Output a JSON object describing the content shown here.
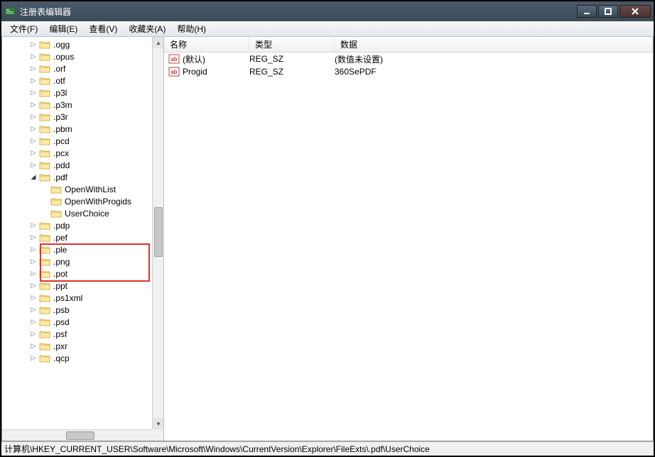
{
  "title": "注册表编辑器",
  "menu": [
    "文件(F)",
    "编辑(E)",
    "查看(V)",
    "收藏夹(A)",
    "帮助(H)"
  ],
  "tree": {
    "indent_base": 38,
    "child_indent": 54,
    "items": [
      {
        "label": ".ogg",
        "expander": "closed"
      },
      {
        "label": ".opus",
        "expander": "closed"
      },
      {
        "label": ".orf",
        "expander": "closed"
      },
      {
        "label": ".otf",
        "expander": "closed"
      },
      {
        "label": ".p3l",
        "expander": "closed"
      },
      {
        "label": ".p3m",
        "expander": "closed"
      },
      {
        "label": ".p3r",
        "expander": "closed"
      },
      {
        "label": ".pbm",
        "expander": "closed"
      },
      {
        "label": ".pcd",
        "expander": "closed"
      },
      {
        "label": ".pcx",
        "expander": "closed"
      },
      {
        "label": ".pdd",
        "expander": "closed"
      },
      {
        "label": ".pdf",
        "expander": "open",
        "children": [
          {
            "label": "OpenWithList"
          },
          {
            "label": "OpenWithProgids"
          },
          {
            "label": "UserChoice"
          }
        ]
      },
      {
        "label": ".pdp",
        "expander": "closed"
      },
      {
        "label": ".pef",
        "expander": "closed"
      },
      {
        "label": ".ple",
        "expander": "closed"
      },
      {
        "label": ".png",
        "expander": "closed"
      },
      {
        "label": ".pot",
        "expander": "closed"
      },
      {
        "label": ".ppt",
        "expander": "closed"
      },
      {
        "label": ".ps1xml",
        "expander": "closed"
      },
      {
        "label": ".psb",
        "expander": "closed"
      },
      {
        "label": ".psd",
        "expander": "closed"
      },
      {
        "label": ".psf",
        "expander": "closed"
      },
      {
        "label": ".pxr",
        "expander": "closed"
      },
      {
        "label": ".qcp",
        "expander": "closed"
      }
    ]
  },
  "list": {
    "columns": {
      "name": "名称",
      "type": "类型",
      "data": "数据"
    },
    "rows": [
      {
        "name": "(默认)",
        "type": "REG_SZ",
        "data": "(数值未设置)"
      },
      {
        "name": "Progid",
        "type": "REG_SZ",
        "data": "360SePDF"
      }
    ]
  },
  "statusbar": "计算机\\HKEY_CURRENT_USER\\Software\\Microsoft\\Windows\\CurrentVersion\\Explorer\\FileExts\\.pdf\\UserChoice"
}
